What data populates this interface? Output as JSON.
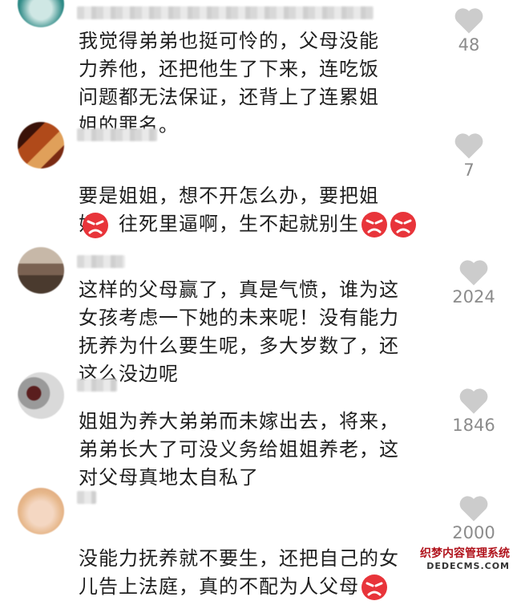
{
  "comments": [
    {
      "text": "我觉得弟弟也挺可怜的，父母没能\n力养他，还把他生了下来，连吃饭\n问题都无法保证，还背上了连累姐\n姐的罪名。",
      "likes": "48",
      "avatar_colors": [
        "#2e8a86",
        "#cfe7e4"
      ],
      "emojis": []
    },
    {
      "text": "要是姐姐，想不开怎么办，要把姐\n姐，往死里逼啊，生不起就别生",
      "likes": "7",
      "avatar_colors": [
        "#7a2a12",
        "#e0a05a"
      ],
      "emojis": [
        "angry-emoji",
        "angry-emoji",
        "angry-emoji"
      ]
    },
    {
      "text": "这样的父母赢了，真是气愤，谁为这\n女孩考虑一下她的未来呢！没有能力\n抚养为什么要生呢，多大岁数了，还\n这么没边呢",
      "likes": "2024",
      "avatar_colors": [
        "#4a3a2e",
        "#c7b8a8"
      ],
      "emojis": []
    },
    {
      "text": "姐姐为养大弟弟而未嫁出去，将来，\n弟弟长大了可没义务给姐姐养老，这\n对父母真地太自私了",
      "likes": "1846",
      "avatar_colors": [
        "#5a1e1e",
        "#d9d9d9"
      ],
      "emojis": []
    },
    {
      "text": "没能力抚养就不要生，还把自己的女\n儿告上法庭，真的不配为人父母",
      "likes": "2000",
      "avatar_colors": [
        "#e7b88c",
        "#f4d7c2"
      ],
      "emojis": [
        "angry-emoji"
      ]
    }
  ],
  "watermark": {
    "cn": "织梦内容管理系统",
    "en": "DEDECMS.COM"
  },
  "colors": {
    "text": "#1f1f1f",
    "count": "#8c8c8c",
    "heart": "#cccccc",
    "emoji_red": "#e8343a"
  }
}
